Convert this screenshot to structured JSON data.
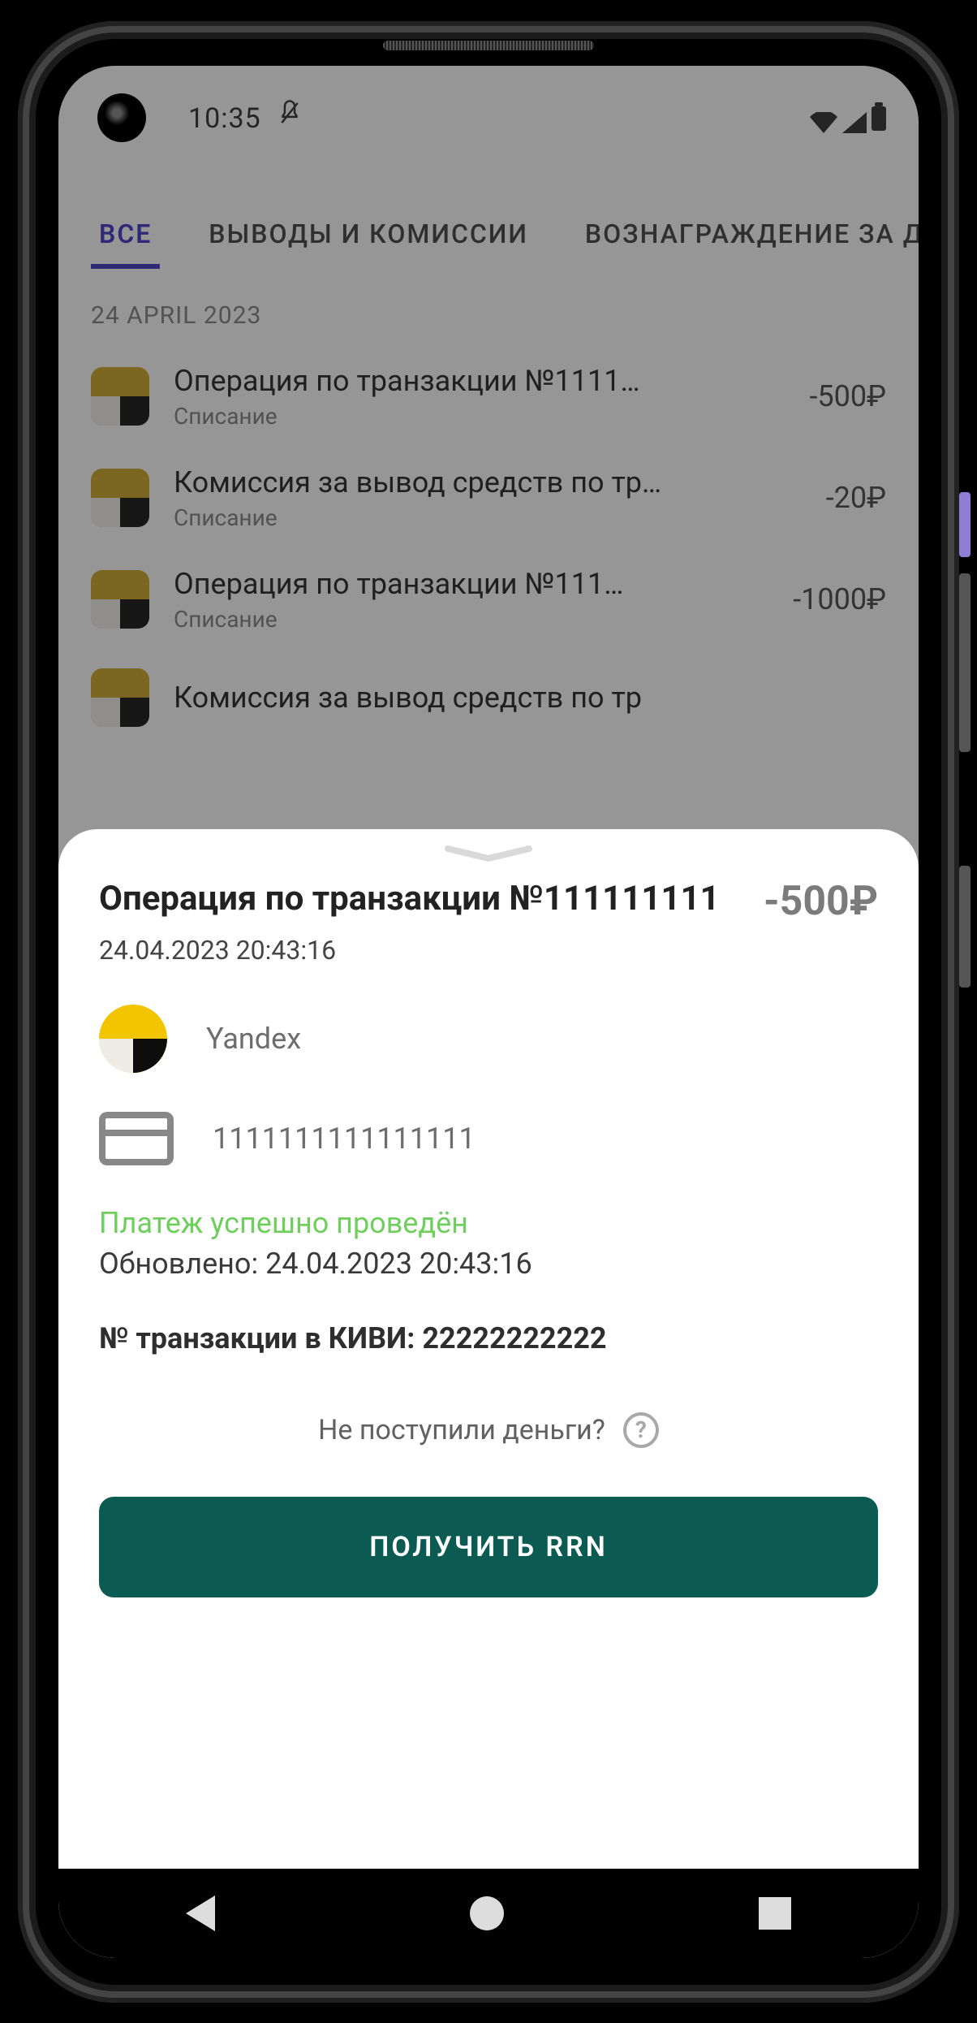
{
  "statusbar": {
    "time": "10:35"
  },
  "tabs": [
    {
      "label": "ВСЕ",
      "active": true
    },
    {
      "label": "ВЫВОДЫ И КОМИССИИ"
    },
    {
      "label": "ВОЗНАГРАЖДЕНИЕ ЗА ДР"
    }
  ],
  "list": {
    "date_header": "24 APRIL 2023",
    "rows": [
      {
        "title": "Операция по транзакции №1111…",
        "sub": "Списание",
        "amount": "-500₽"
      },
      {
        "title": "Комиссия за вывод средств по тр…",
        "sub": "Списание",
        "amount": "-20₽"
      },
      {
        "title": "Операция по транзакции №111…",
        "sub": "Списание",
        "amount": "-1000₽"
      },
      {
        "title": "Комиссия за вывод средств по тр",
        "sub": "",
        "amount": ""
      }
    ]
  },
  "sheet": {
    "title": "Операция по транзакции №111111111",
    "amount": "-500₽",
    "timestamp": "24.04.2023 20:43:16",
    "merchant": "Yandex",
    "card_number": "1111111111111111",
    "status_text": "Платеж успешно проведён",
    "updated_text": "Обновлено: 24.04.2023 20:43:16",
    "kiwi_text": "№ транзакции в КИВИ: 22222222222",
    "help_text": "Не поступили деньги?",
    "cta_label": "ПОЛУЧИТЬ RRN"
  }
}
